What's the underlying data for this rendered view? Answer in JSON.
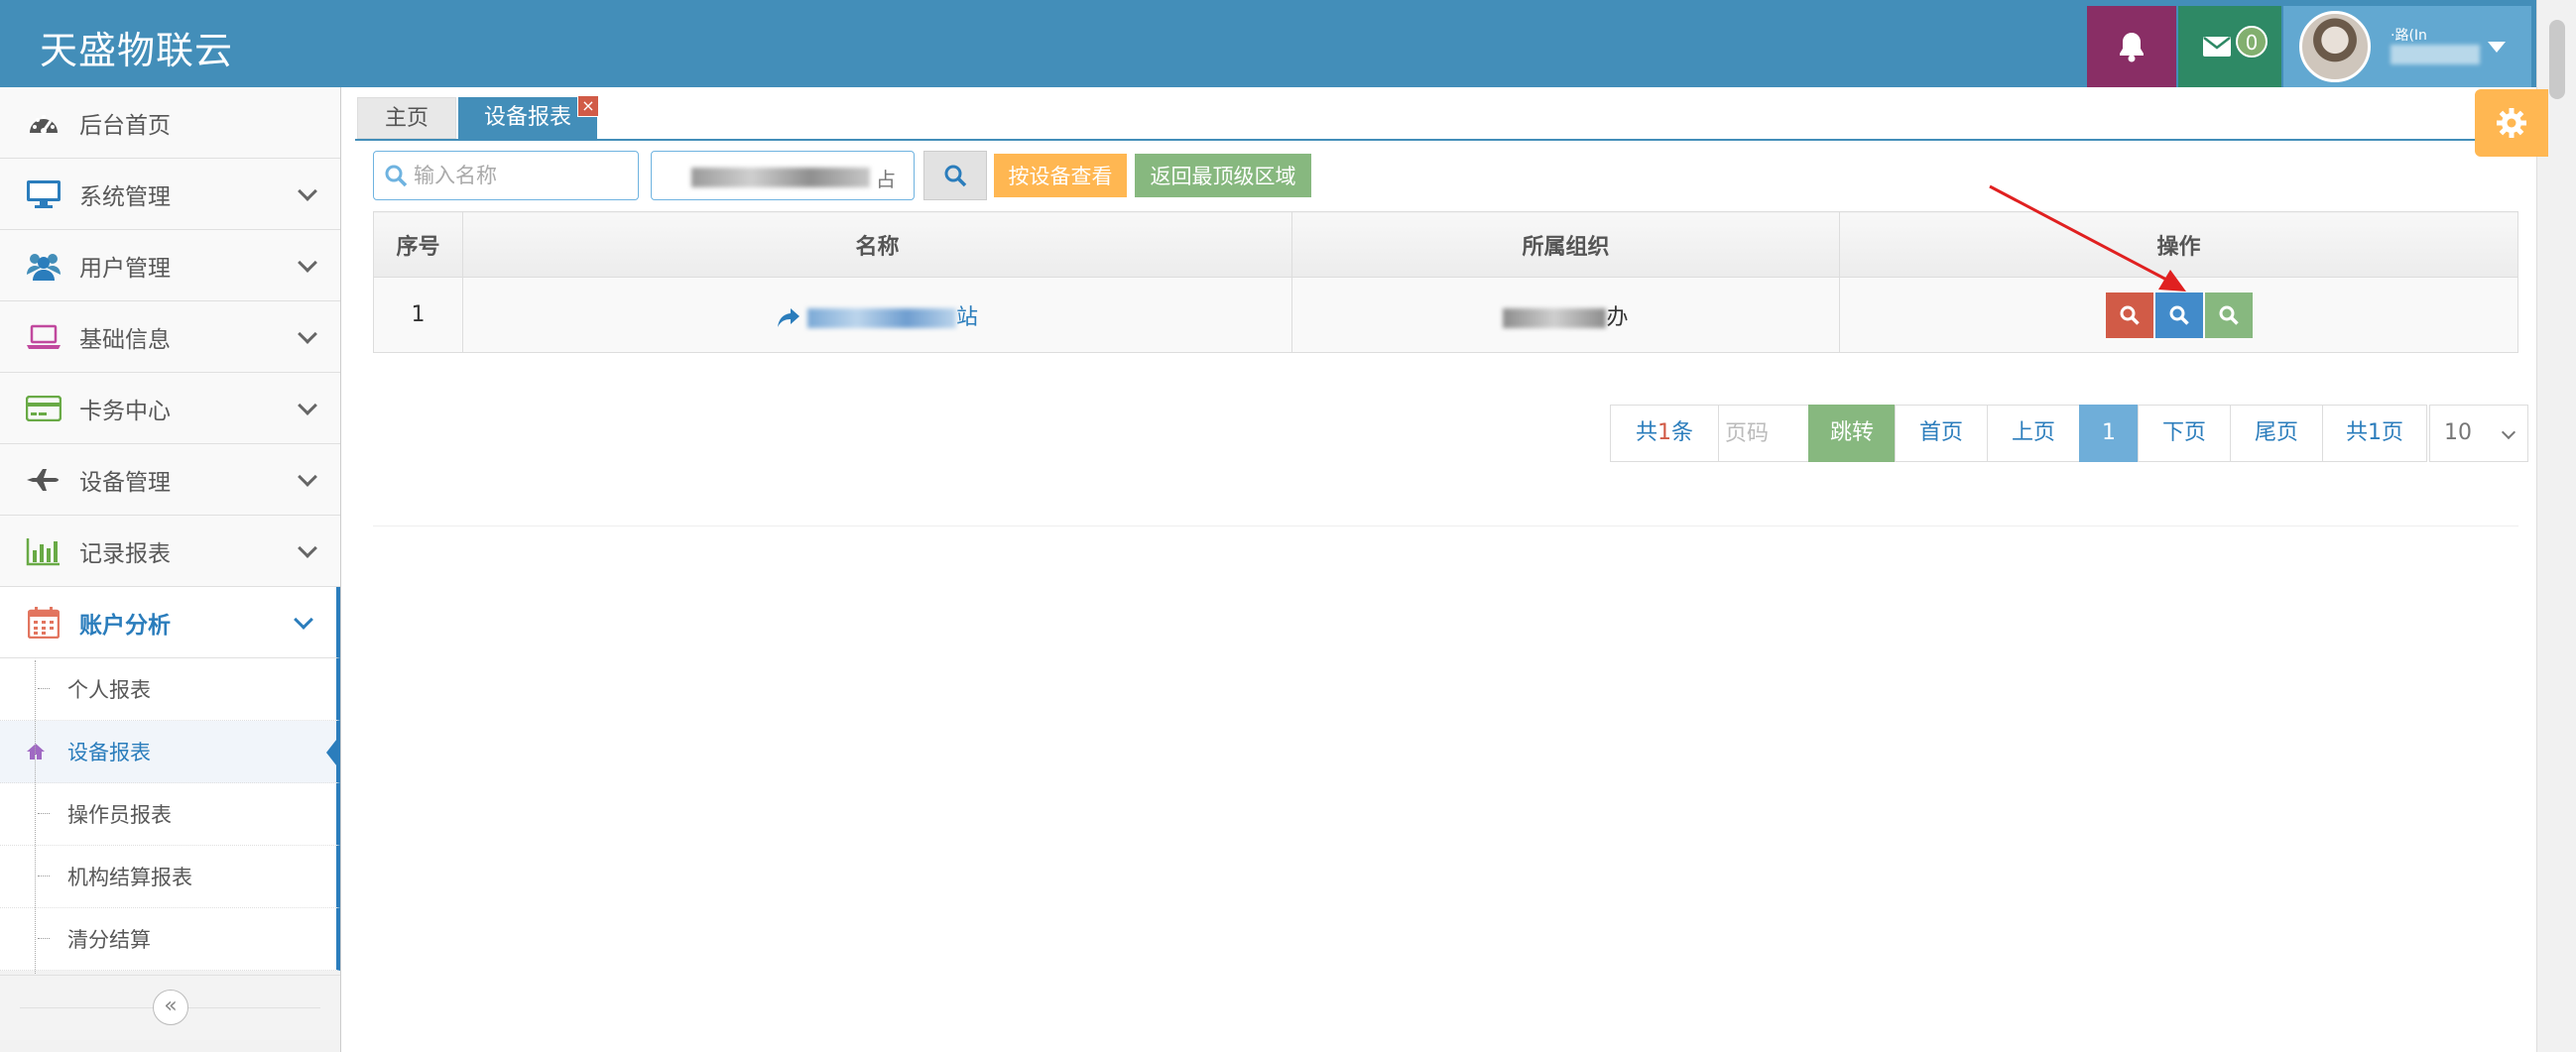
{
  "header": {
    "brand": "天盛物联云",
    "message_count": "0",
    "user_name_visible": "·路(In",
    "colors": {
      "header_bg": "#438eb9",
      "bell_bg": "#892e65",
      "msg_bg": "#2e8965",
      "user_bg": "#62a8d1"
    }
  },
  "sidebar": {
    "items": [
      {
        "label": "后台首页",
        "icon": "dashboard-icon"
      },
      {
        "label": "系统管理",
        "icon": "desktop-icon"
      },
      {
        "label": "用户管理",
        "icon": "users-icon"
      },
      {
        "label": "基础信息",
        "icon": "laptop-icon"
      },
      {
        "label": "卡务中心",
        "icon": "credit-card-icon"
      },
      {
        "label": "设备管理",
        "icon": "plane-icon"
      },
      {
        "label": "记录报表",
        "icon": "bar-chart-icon"
      },
      {
        "label": "账户分析",
        "icon": "calendar-icon"
      }
    ],
    "subitems": [
      {
        "label": "个人报表"
      },
      {
        "label": "设备报表"
      },
      {
        "label": "操作员报表"
      },
      {
        "label": "机构结算报表"
      },
      {
        "label": "清分结算"
      }
    ]
  },
  "tabs": {
    "home": "主页",
    "device_report": "设备报表",
    "close": "×"
  },
  "toolbar": {
    "search_placeholder": "输入名称",
    "org_suffix": "占",
    "by_device": "按设备查看",
    "back_to_top": "返回最顶级区域"
  },
  "table": {
    "headers": [
      "序号",
      "名称",
      "所属组织",
      "操作"
    ],
    "rows": [
      {
        "index": "1",
        "name_visible": "站",
        "org_visible": "办"
      }
    ]
  },
  "pagination": {
    "total_prefix": "共",
    "total_num": "1",
    "total_suffix": "条",
    "page_placeholder": "页码",
    "jump": "跳转",
    "first": "首页",
    "prev": "上页",
    "current": "1",
    "next": "下页",
    "last": "尾页",
    "pages": "共1页",
    "page_size": "10"
  }
}
